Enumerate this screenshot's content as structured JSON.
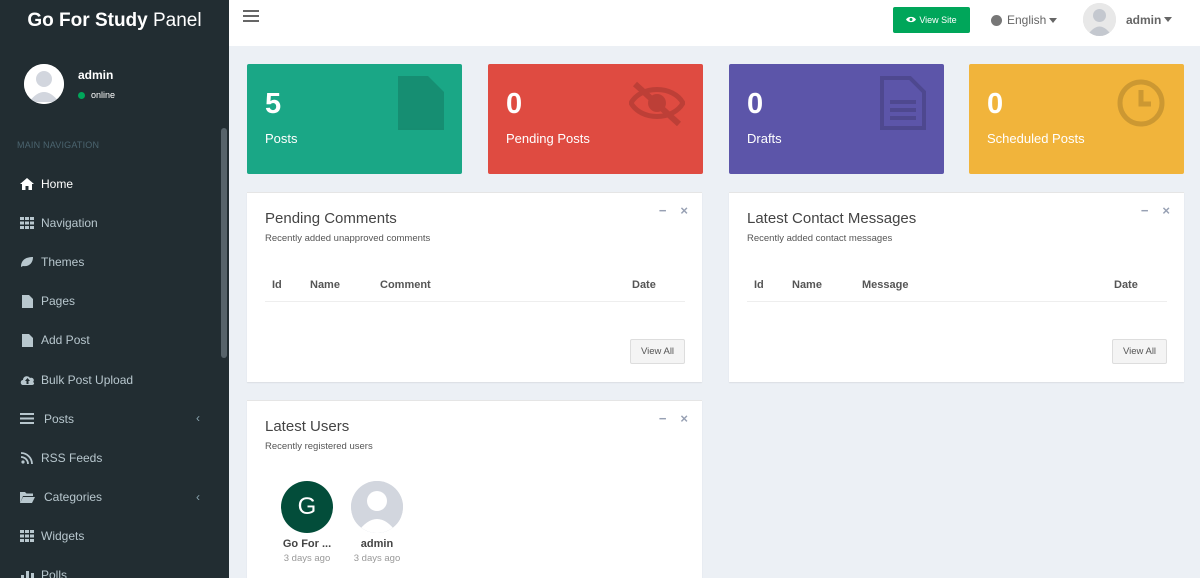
{
  "brand": {
    "bold": "Go For Study",
    "light": "Panel"
  },
  "sidebar": {
    "user": {
      "name": "admin",
      "status": "online"
    },
    "header": "MAIN NAVIGATION",
    "items": [
      {
        "label": "Home",
        "icon": "home-icon",
        "active": true
      },
      {
        "label": "Navigation",
        "icon": "grid-icon"
      },
      {
        "label": "Themes",
        "icon": "leaf-icon"
      },
      {
        "label": "Pages",
        "icon": "file-icon"
      },
      {
        "label": "Add Post",
        "icon": "file-icon"
      },
      {
        "label": "Bulk Post Upload",
        "icon": "cloud-upload-icon"
      },
      {
        "label": "Posts",
        "icon": "list-icon",
        "chevron": "‹"
      },
      {
        "label": "RSS Feeds",
        "icon": "rss-icon"
      },
      {
        "label": "Categories",
        "icon": "folder-icon",
        "chevron": "‹"
      },
      {
        "label": "Widgets",
        "icon": "grid-icon"
      },
      {
        "label": "Polls",
        "icon": "bar-icon"
      }
    ]
  },
  "topbar": {
    "view_site": "View Site",
    "language": "English",
    "user": "admin"
  },
  "stats": [
    {
      "value": "5",
      "label": "Posts",
      "color": "#1aa786",
      "icon": "file-icon"
    },
    {
      "value": "0",
      "label": "Pending Posts",
      "color": "#df4b41",
      "icon": "eye-slash-icon"
    },
    {
      "value": "0",
      "label": "Drafts",
      "color": "#5c55a9",
      "icon": "file-text-icon"
    },
    {
      "value": "0",
      "label": "Scheduled Posts",
      "color": "#f1b43b",
      "icon": "clock-icon"
    }
  ],
  "pending_comments": {
    "title": "Pending Comments",
    "subtitle": "Recently added unapproved comments",
    "columns": [
      "Id",
      "Name",
      "Comment",
      "Date"
    ],
    "button": "View All",
    "min": "−",
    "close": "×"
  },
  "contact_messages": {
    "title": "Latest Contact Messages",
    "subtitle": "Recently added contact messages",
    "columns": [
      "Id",
      "Name",
      "Message",
      "Date"
    ],
    "button": "View All",
    "min": "−",
    "close": "×"
  },
  "latest_users": {
    "title": "Latest Users",
    "subtitle": "Recently registered users",
    "min": "−",
    "close": "×",
    "users": [
      {
        "name": "Go For ...",
        "time": "3 days ago",
        "initial": "G",
        "color": "#034d3a"
      },
      {
        "name": "admin",
        "time": "3 days ago",
        "initial": "",
        "color": "#d2d6de"
      }
    ]
  }
}
